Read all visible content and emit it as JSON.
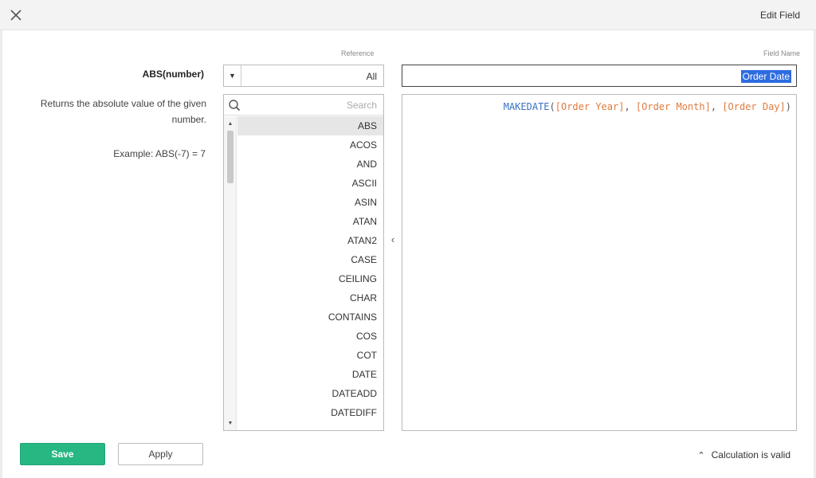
{
  "window": {
    "title": "Edit Field"
  },
  "field_name": {
    "label": "Field Name",
    "value": "Order Date"
  },
  "reference": {
    "label": "Reference",
    "selected": "All"
  },
  "search": {
    "placeholder": "Search"
  },
  "functions": [
    "ABS",
    "ACOS",
    "AND",
    "ASCII",
    "ASIN",
    "ATAN",
    "ATAN2",
    "CASE",
    "CEILING",
    "CHAR",
    "CONTAINS",
    "COS",
    "COT",
    "DATE",
    "DATEADD",
    "DATEDIFF"
  ],
  "selected_function": "ABS",
  "formula": {
    "fn": "MAKEDATE",
    "args": [
      "[Order Year]",
      "[Order Month]",
      "[Order Day]"
    ]
  },
  "help": {
    "signature": "ABS(number)",
    "description": "Returns the absolute value of the given number.",
    "example": "Example: ABS(-7) = 7"
  },
  "footer": {
    "save_label": "Save",
    "apply_label": "Apply",
    "status": "Calculation is valid"
  },
  "colors": {
    "save": "#27b783",
    "highlight": "#2d6ce0",
    "formula_fn": "#3a73c4",
    "formula_field": "#e07b3e"
  }
}
